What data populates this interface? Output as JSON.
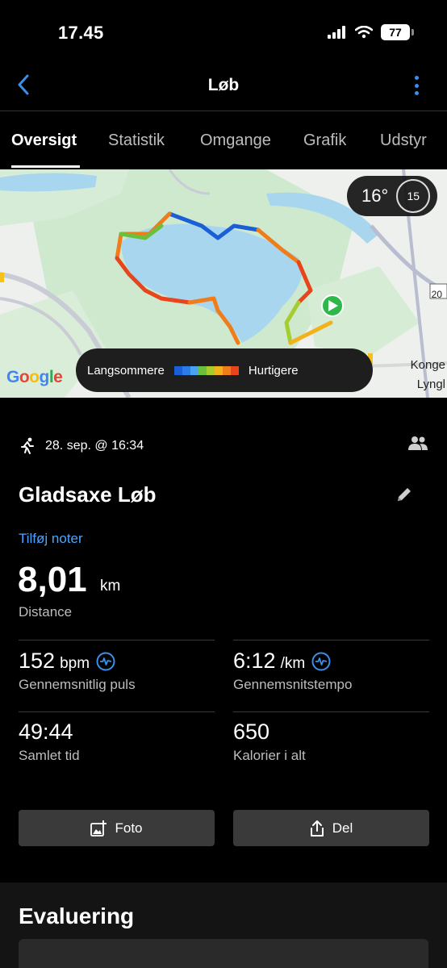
{
  "status_bar": {
    "time": "17.45",
    "battery": "77"
  },
  "header": {
    "title": "Løb"
  },
  "tabs": [
    {
      "label": "Oversigt",
      "active": true
    },
    {
      "label": "Statistik",
      "active": false
    },
    {
      "label": "Omgange",
      "active": false
    },
    {
      "label": "Grafik",
      "active": false
    },
    {
      "label": "Udstyr",
      "active": false
    }
  ],
  "map": {
    "temperature": "16°",
    "wind_speed": "15",
    "legend_slow": "Langsommere",
    "legend_fast": "Hurtigere",
    "legend_colors": [
      "#1a5fd6",
      "#2b7be8",
      "#4aa3f0",
      "#6bbf3c",
      "#a6cc2e",
      "#f2b21b",
      "#f07d1a",
      "#e8451c"
    ],
    "provider": "Google",
    "place_labels": [
      "Konge",
      "Lyngl"
    ],
    "road_number": "20"
  },
  "activity": {
    "date": "28. sep. @ 16:34",
    "title": "Gladsaxe Løb",
    "add_notes": "Tilføj noter",
    "distance": {
      "value": "8,01",
      "unit": "km",
      "label": "Distance"
    },
    "stats": [
      {
        "value": "152",
        "unit": "bpm",
        "label": "Gennemsnitlig puls",
        "icon": "heart-rate-icon"
      },
      {
        "value": "6:12",
        "unit": "/km",
        "label": "Gennemsnitstempo",
        "icon": "heart-rate-icon"
      },
      {
        "value": "49:44",
        "unit": "",
        "label": "Samlet tid"
      },
      {
        "value": "650",
        "unit": "",
        "label": "Kalorier i alt"
      }
    ]
  },
  "actions": {
    "photo": "Foto",
    "share": "Del"
  },
  "evaluation": {
    "title": "Evaluering"
  },
  "colors": {
    "accent": "#3b8fe8",
    "link": "#4ea3ff",
    "background": "#000000",
    "button": "#3a3a3a"
  }
}
